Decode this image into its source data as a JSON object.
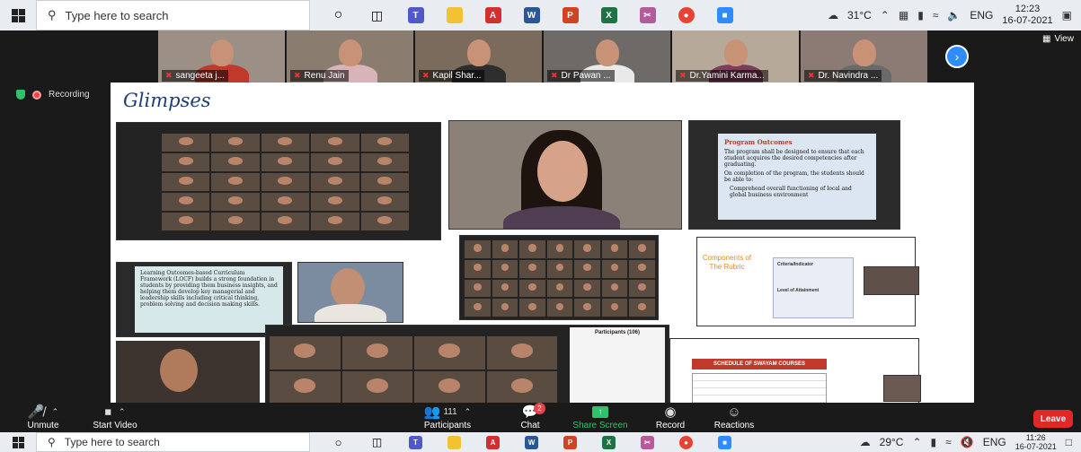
{
  "top_taskbar": {
    "search_placeholder": "Type here to search",
    "weather": "31°C",
    "language": "ENG",
    "time": "12:23",
    "date": "16-07-2021"
  },
  "participants_strip": [
    {
      "name": "sangeeta j...",
      "bg": "#9b8f86",
      "shirt": "#c0392b"
    },
    {
      "name": "Renu Jain",
      "bg": "#8a7d70",
      "shirt": "#d8b4b8"
    },
    {
      "name": "Kapil Shar...",
      "bg": "#7a6b5c",
      "shirt": "#2e2e2e"
    },
    {
      "name": "Dr Pawan ...",
      "bg": "#6d6a68",
      "shirt": "#e9e9e9"
    },
    {
      "name": "Dr.Yamini Karma...",
      "bg": "#b7a99a",
      "shirt": "#7b3d5a"
    },
    {
      "name": "Dr. Navindra ...",
      "bg": "#8c7a74",
      "shirt": "#6a6a6a"
    }
  ],
  "view_label": "View",
  "recording_label": "Recording",
  "slide": {
    "title": "Glimpses",
    "program_outcomes": {
      "heading": "Program Outcomes",
      "line1": "The program shall be designed to ensure that each student acquires the desired competencies after graduating.",
      "line2": "On completion of the program, the students should be able to:",
      "line3": "Comprehend overall functioning of local and global business environment"
    },
    "rubric": {
      "left_title": "Components of The Rubric",
      "criteria": "Criteria/Indicator",
      "level": "Level of Attainment"
    },
    "locf_text": "Learning Outcomes-based Curriculum Framework (LOCF) builds a strong foundation in students by providing them business insights, and helping them develop key managerial and leadership skills including critical thinking, problem solving and decision making skills.",
    "participants_panel_title": "Participants (106)",
    "swayam_title": "SCHEDULE OF SWAYAM COURSES"
  },
  "controls": {
    "unmute": "Unmute",
    "start_video": "Start Video",
    "participants": "Participants",
    "participants_count": "111",
    "chat": "Chat",
    "chat_badge": "2",
    "share_screen": "Share Screen",
    "record": "Record",
    "reactions": "Reactions",
    "leave": "Leave"
  },
  "bottom_taskbar": {
    "search_placeholder": "Type here to search",
    "weather": "29°C",
    "language": "ENG",
    "time": "11:26",
    "date": "16-07-2021"
  },
  "colors": {
    "zoom_blue": "#2d8cff",
    "leave_red": "#e02828",
    "share_green": "#2ec26b",
    "slide_title": "#1e3e72"
  }
}
